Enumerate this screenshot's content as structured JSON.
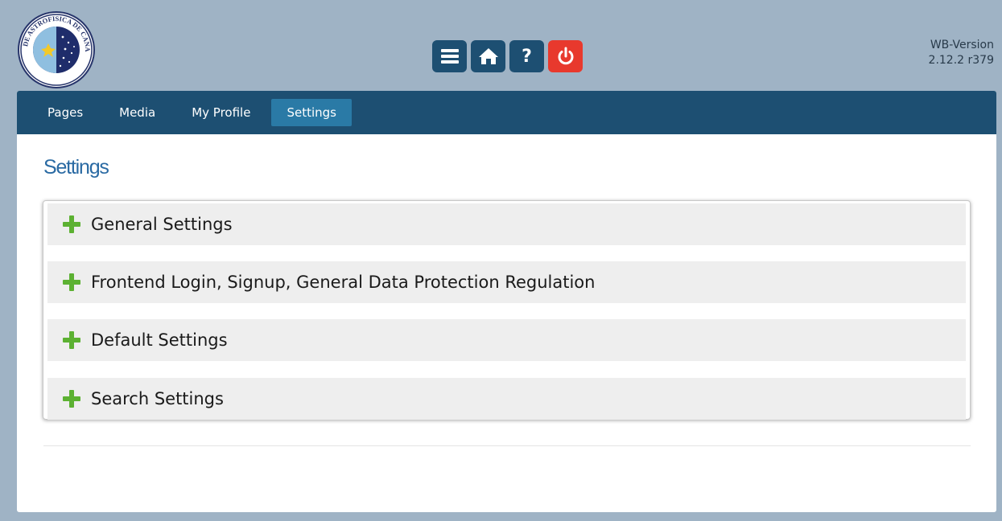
{
  "header": {
    "logo": {
      "icon": "institute-seal-logo",
      "text": "INSTITUTO DE ASTROFISICA DE CANARIAS · IAC"
    },
    "toolbar": [
      {
        "icon": "menu-icon",
        "color": "#1d4f72"
      },
      {
        "icon": "home-icon",
        "color": "#1d4f72"
      },
      {
        "icon": "help-icon",
        "symbol": "?",
        "color": "#1d4f72"
      },
      {
        "icon": "power-icon",
        "color": "#e8392d"
      }
    ],
    "version": {
      "line1": "WB-Version",
      "line2": "2.12.2 r379"
    }
  },
  "nav": {
    "items": [
      {
        "label": "Pages"
      },
      {
        "label": "Media"
      },
      {
        "label": "My Profile"
      },
      {
        "label": "Settings",
        "active": true
      }
    ]
  },
  "main": {
    "title": "Settings",
    "sections": [
      {
        "label": "General Settings",
        "icon": "plus-icon"
      },
      {
        "label": "Frontend Login, Signup, General Data Protection Regulation",
        "icon": "plus-icon"
      },
      {
        "label": "Default Settings",
        "icon": "plus-icon"
      },
      {
        "label": "Search Settings",
        "icon": "plus-icon"
      }
    ]
  },
  "colors": {
    "background": "#9fb3c5",
    "navbar": "#1d4f72",
    "nav_active": "#2a7aa6",
    "title": "#2a6aa3",
    "plus": "#5cb132",
    "logout": "#e8392d"
  }
}
